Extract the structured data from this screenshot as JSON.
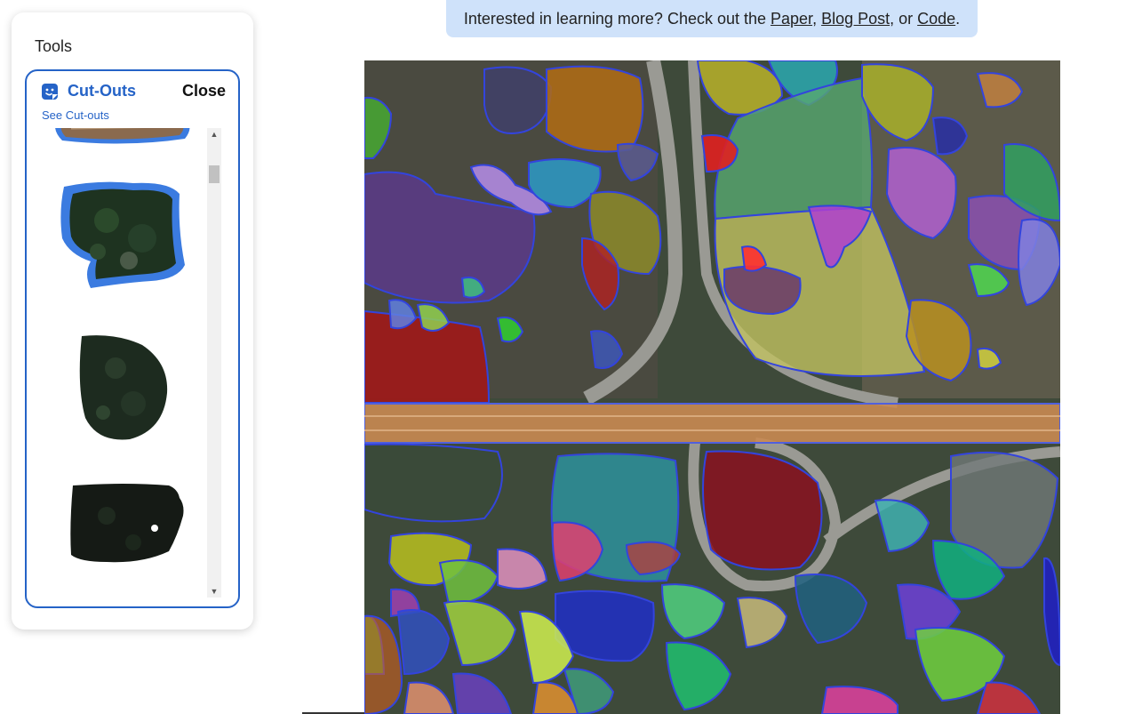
{
  "sidebar": {
    "title": "Tools",
    "card": {
      "title": "Cut-Outs",
      "close_label": "Close",
      "see_link": "See Cut-outs",
      "icon": "sticker-icon"
    },
    "cutouts": [
      {
        "name": "cutout-road-segment"
      },
      {
        "name": "cutout-forest-block"
      },
      {
        "name": "cutout-teardrop-field"
      },
      {
        "name": "cutout-dark-field"
      }
    ]
  },
  "banner": {
    "prefix": "Interested in learning more? Check out the ",
    "paper": "Paper",
    "sep1": ", ",
    "blog": "Blog Post",
    "sep2": ", or ",
    "code": "Code",
    "suffix": "."
  },
  "colors": {
    "accent": "#2563c7",
    "banner_bg": "#cfe2fa",
    "highway": "#c98a52"
  }
}
